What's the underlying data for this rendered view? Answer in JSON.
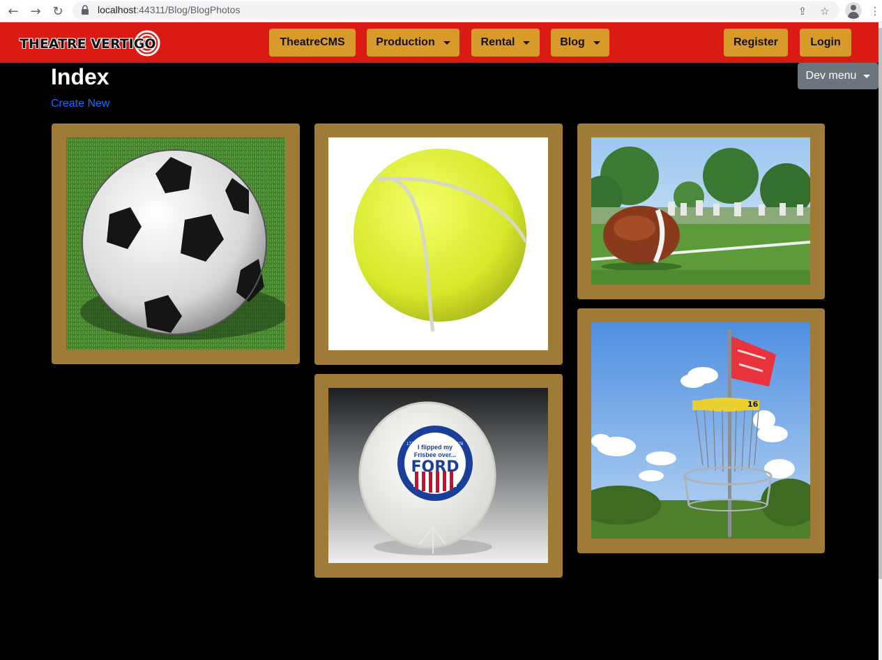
{
  "browser": {
    "url_host": "localhost",
    "url_rest": ":44311/Blog/BlogPhotos"
  },
  "navbar": {
    "logo_text": "THEATRE VERTIGO",
    "items": [
      {
        "label": "TheatreCMS"
      },
      {
        "label": "Production"
      },
      {
        "label": "Rental"
      },
      {
        "label": "Blog"
      }
    ],
    "register_label": "Register",
    "login_label": "Login"
  },
  "dev_menu_label": "Dev menu",
  "page": {
    "title": "Index",
    "create_link": "Create New"
  },
  "photos": [
    {
      "subject": "soccer ball on grass"
    },
    {
      "subject": "tennis ball"
    },
    {
      "subject": "american football on field"
    },
    {
      "subject": "frisbee on stand"
    },
    {
      "subject": "disc golf basket with flag"
    }
  ],
  "frisbee_text": {
    "line1": "I flipped my",
    "line2": "Frisbee over...",
    "line3": "FORD",
    "year_left": "1776",
    "year_right": "1976"
  },
  "flag_number": "16",
  "colors": {
    "navbar": "#dc1a14",
    "nav_button": "#d89b2a",
    "card_frame": "#a07b38",
    "link": "#0d6efd",
    "dev_menu": "#6c757d"
  }
}
